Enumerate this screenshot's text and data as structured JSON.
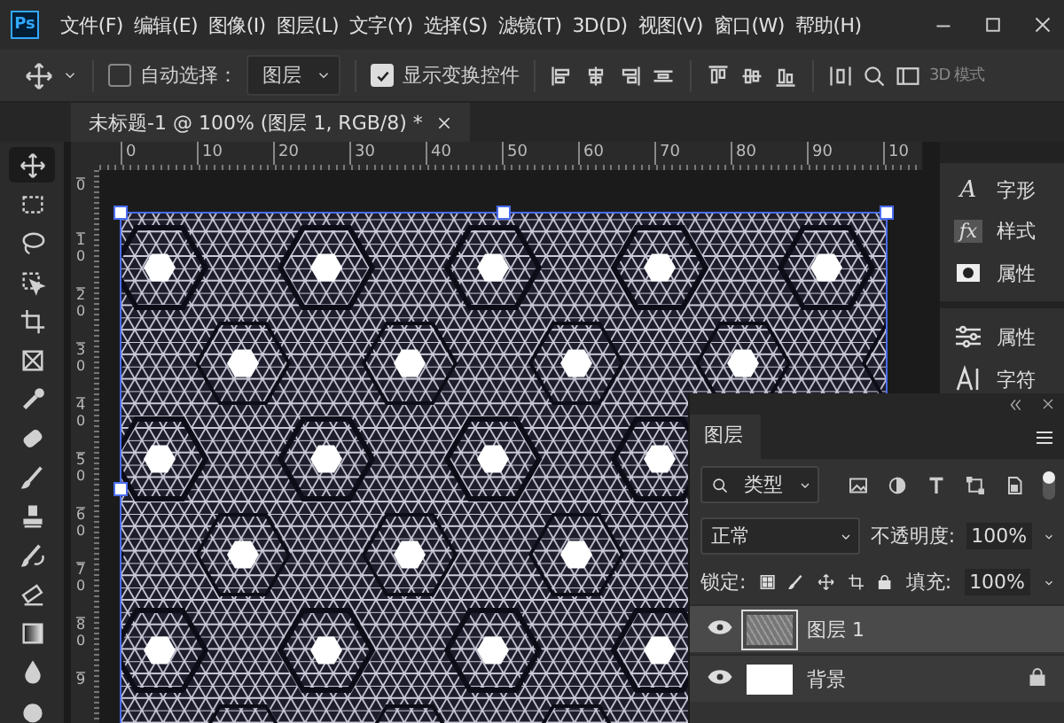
{
  "menubar": {
    "logo": "Ps",
    "items": [
      "文件(F)",
      "编辑(E)",
      "图像(I)",
      "图层(L)",
      "文字(Y)",
      "选择(S)",
      "滤镜(T)",
      "3D(D)",
      "视图(V)",
      "窗口(W)",
      "帮助(H)"
    ]
  },
  "options_bar": {
    "auto_select": {
      "label": "自动选择：",
      "checked": false
    },
    "target": "图层",
    "show_transform": {
      "label": "显示变换控件",
      "checked": true
    },
    "mode_3d": "3D 模式"
  },
  "document_tab": {
    "title": "未标题-1 @ 100% (图层 1, RGB/8) *"
  },
  "rulers": {
    "horizontal": [
      "0",
      "10",
      "20",
      "30",
      "40",
      "50",
      "60",
      "70",
      "80",
      "90",
      "10"
    ],
    "vertical": [
      "0",
      "10",
      "20",
      "30",
      "40",
      "50",
      "60",
      "70",
      "80",
      "9"
    ]
  },
  "tools": [
    {
      "kind": "move",
      "selected": true
    },
    {
      "kind": "marquee",
      "selected": false
    },
    {
      "kind": "lasso",
      "selected": false
    },
    {
      "kind": "object",
      "selected": false
    },
    {
      "kind": "crop",
      "selected": false
    },
    {
      "kind": "frame",
      "selected": false
    },
    {
      "kind": "eyedropper",
      "selected": false
    },
    {
      "kind": "healing",
      "selected": false
    },
    {
      "kind": "brush",
      "selected": false
    },
    {
      "kind": "stamp",
      "selected": false
    },
    {
      "kind": "history",
      "selected": false
    },
    {
      "kind": "eraser",
      "selected": false
    },
    {
      "kind": "gradient",
      "selected": false
    },
    {
      "kind": "blur",
      "selected": false
    },
    {
      "kind": "dodge",
      "selected": false
    }
  ],
  "side_panels": [
    [
      {
        "kind": "glyphs",
        "icon": "A",
        "label": "字形"
      },
      {
        "kind": "styles",
        "icon": "fx",
        "label": "样式"
      },
      {
        "kind": "properties",
        "label": "属性"
      }
    ],
    [
      {
        "kind": "adjust",
        "label": "属性"
      },
      {
        "kind": "character",
        "label": "字符"
      }
    ]
  ],
  "layers_panel": {
    "title": "图层",
    "filter": "类型",
    "blend_mode": "正常",
    "opacity_label": "不透明度:",
    "opacity": "100%",
    "lock_label": "锁定:",
    "fill_label": "填充:",
    "fill": "100%",
    "layers": [
      {
        "name": "图层 1",
        "kind": "pattern",
        "selected": true,
        "visible": true,
        "locked": false
      },
      {
        "name": "背景",
        "kind": "white",
        "selected": false,
        "visible": true,
        "locked": true
      }
    ]
  }
}
